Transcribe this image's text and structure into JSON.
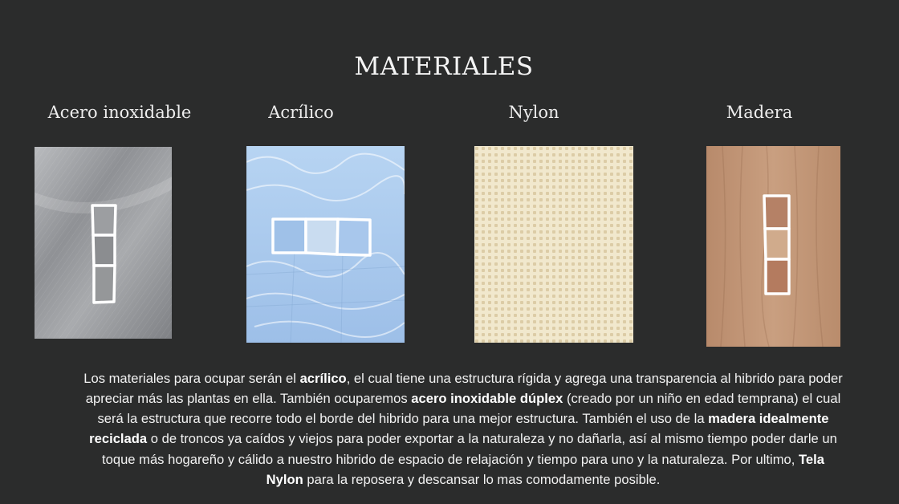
{
  "section": {
    "title": "MATERIALES"
  },
  "materials": [
    {
      "label": "Acero inoxidable",
      "texture": "brushed-steel",
      "color": "#9a9c9f"
    },
    {
      "label": "Acrílico",
      "texture": "water-acrylic",
      "color": "#a9c9ec"
    },
    {
      "label": "Nylon",
      "texture": "woven-nylon",
      "color": "#ede3c4"
    },
    {
      "label": "Madera",
      "texture": "wood",
      "color": "#c49a7c"
    }
  ],
  "description": {
    "t1": "Los materiales para ocupar serán el ",
    "b1": "acrílico",
    "t2": ", el cual tiene una estructura rígida y agrega una transparencia al hibrido para poder apreciar más las plantas en ella. También ocuparemos ",
    "b2": "acero inoxidable dúplex",
    "t3": " (creado por un niño en edad temprana) el cual será la estructura que recorre todo el borde del hibrido para una mejor estructura. También el uso de la ",
    "b3": "madera idealmente reciclada",
    "t4": " o de troncos ya caídos y viejos para poder exportar a la naturaleza y no dañarla, así al mismo tiempo poder darle un toque más hogareño y cálido a nuestro hibrido de espacio de relajación y tiempo para uno y la naturaleza. Por ultimo, ",
    "b4": "Tela Nylon",
    "t5": " para la reposera y descansar lo mas comodamente posible."
  }
}
